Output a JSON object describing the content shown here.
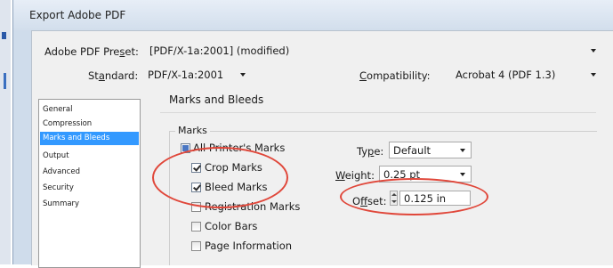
{
  "window": {
    "title": "Export Adobe PDF"
  },
  "preset": {
    "label": "Adobe PDF Preset:",
    "value": "[PDF/X-1a:2001] (modified)"
  },
  "standard": {
    "label": "Standard:",
    "value": "PDF/X-1a:2001"
  },
  "compatibility": {
    "label": "Compatibility:",
    "value": "Acrobat 4 (PDF 1.3)"
  },
  "sidebar": {
    "items": [
      {
        "label": "General"
      },
      {
        "label": "Compression"
      },
      {
        "label": "Marks and Bleeds",
        "selected": true
      },
      {
        "label": "Output"
      },
      {
        "label": "Advanced"
      },
      {
        "label": "Security"
      },
      {
        "label": "Summary"
      }
    ]
  },
  "section": {
    "title": "Marks and Bleeds"
  },
  "marks": {
    "group_label": "Marks",
    "all_printers_marks": {
      "label": "All Printer's Marks",
      "state": "mixed"
    },
    "crop_marks": {
      "label": "Crop Marks",
      "checked": true
    },
    "bleed_marks": {
      "label": "Bleed Marks",
      "checked": true
    },
    "registration_marks": {
      "label": "Registration Marks",
      "checked": false
    },
    "color_bars": {
      "label": "Color Bars",
      "checked": false
    },
    "page_information": {
      "label": "Page Information",
      "checked": false
    },
    "type": {
      "label": "Type:",
      "value": "Default"
    },
    "weight": {
      "label": "Weight:",
      "value": "0.25 pt"
    },
    "offset": {
      "label": "Offset:",
      "value": "0.125 in"
    }
  },
  "colors": {
    "highlight_ellipse": "#e0473a",
    "selection": "#3399ff"
  }
}
